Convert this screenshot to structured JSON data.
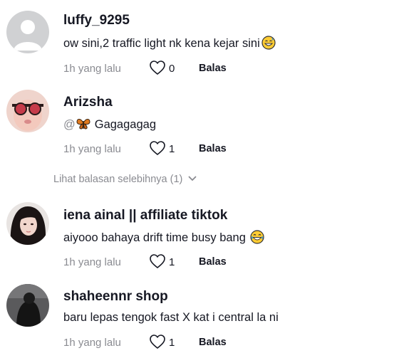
{
  "comments": [
    {
      "username": "luffy_9295",
      "text": "ow sini,2 traffic light nk kena kejar sini",
      "time": "1h yang lalu",
      "likes": "0",
      "reply_label": "Balas",
      "avatar": "default-avatar-icon",
      "emoji": "grinning-sweat-emoji"
    },
    {
      "username": "Arizsha",
      "mention": "@",
      "text": "Gagagagag",
      "time": "1h yang lalu",
      "likes": "1",
      "reply_label": "Balas",
      "emoji": "butterfly-emoji"
    },
    {
      "username": "iena ainal || affiliate tiktok",
      "text": "aiyooo bahaya drift time busy bang",
      "time": "1h yang lalu",
      "likes": "1",
      "reply_label": "Balas",
      "emoji": "tears-of-joy-emoji"
    },
    {
      "username": "shaheennr shop",
      "text": "baru lepas tengok fast X kat i central la ni",
      "time": "1h yang lalu",
      "likes": "1",
      "reply_label": "Balas"
    }
  ],
  "more_replies_label": "Lihat balasan selebihnya (1)",
  "colors": {
    "text_primary": "#161823",
    "text_secondary": "#8a8b91",
    "background": "#ffffff"
  }
}
